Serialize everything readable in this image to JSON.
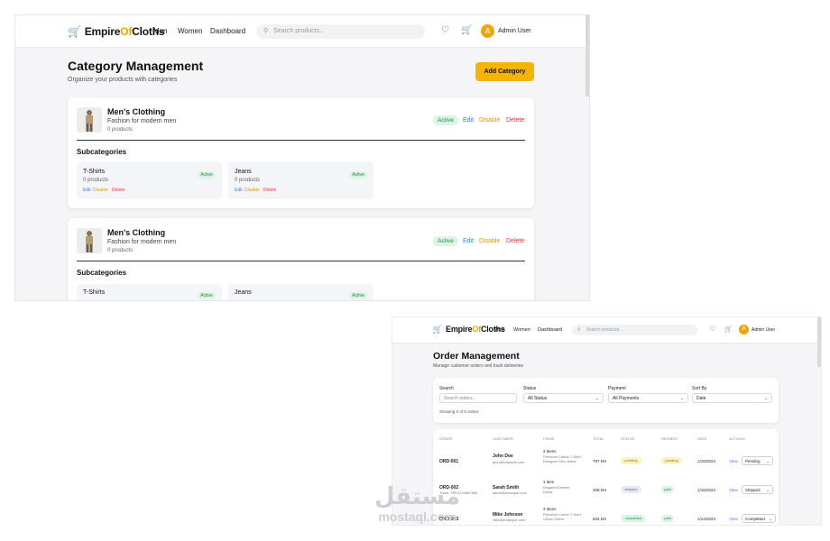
{
  "brand": {
    "prefix": "Empire",
    "accent": "Of",
    "suffix": "Cloths",
    "accent_color": "#f0a500"
  },
  "nav": {
    "links": [
      "Men",
      "Women",
      "Dashboard"
    ],
    "search_placeholder": "Search products...",
    "icons": [
      "heart-icon",
      "cart-icon"
    ],
    "avatar_initial": "A",
    "user_name": "Admin User"
  },
  "category_page": {
    "title": "Category Management",
    "subtitle": "Organize your products with categories",
    "add_button": "Add Category",
    "categories": [
      {
        "name": "Men's Clothing",
        "description": "Fashion for modern men",
        "count": "0 products",
        "status": "Active",
        "actions": {
          "edit": "Edit",
          "disable": "Disable",
          "delete": "Delete"
        },
        "subcategories_title": "Subcategories",
        "subcategories": [
          {
            "name": "T-Shirts",
            "count": "0 products",
            "status": "Active",
            "actions": {
              "edit": "Edit",
              "disable": "Disable",
              "delete": "Delete"
            }
          },
          {
            "name": "Jeans",
            "count": "0 products",
            "status": "Active",
            "actions": {
              "edit": "Edit",
              "disable": "Disable",
              "delete": "Delete"
            }
          }
        ]
      },
      {
        "name": "Men's Clothing",
        "description": "Fashion for modern men",
        "count": "0 products",
        "status": "Active",
        "actions": {
          "edit": "Edit",
          "disable": "Disable",
          "delete": "Delete"
        },
        "subcategories_title": "Subcategories",
        "subcategories": [
          {
            "name": "T-Shirts",
            "status": "Active"
          },
          {
            "name": "Jeans",
            "status": "Active"
          }
        ]
      }
    ]
  },
  "order_page": {
    "title": "Order Management",
    "subtitle": "Manage customer orders and track deliveries",
    "filters": {
      "search_label": "Search",
      "search_placeholder": "Search orders...",
      "status_label": "Status",
      "status_value": "All Status",
      "payment_label": "Payment",
      "payment_value": "All Payments",
      "sort_label": "Sort By",
      "sort_value": "Date",
      "showing": "Showing 5 of 5 orders"
    },
    "columns": [
      "Order",
      "Customer",
      "Items",
      "Total",
      "Status",
      "Payment",
      "Date",
      "Actions"
    ],
    "rows": [
      {
        "order": "ORD-001",
        "tracking": "",
        "customer": "John Doe",
        "email": "john@example.com",
        "items_count": "2 items",
        "items_desc": "Premium Cotton T-Shirt, Designer Slim Jeans",
        "total": "797 DH",
        "status": "pending",
        "payment": "pending",
        "date": "1/15/2024",
        "view": "View",
        "action_value": "Pending"
      },
      {
        "order": "ORD-002",
        "tracking": "Track: TRK1234567890",
        "customer": "Sarah Smith",
        "email": "sarah@example.com",
        "items_count": "1 item",
        "items_desc": "Elegant Summer Dress",
        "total": "208 DH",
        "status": "shipped",
        "payment": "paid",
        "date": "1/15/2024",
        "view": "View",
        "action_value": "Shipped"
      },
      {
        "order": "ORD-003",
        "tracking": "",
        "customer": "Mike Johnson",
        "email": "mike@example.com",
        "items_count": "3 items",
        "items_desc": "Premium Cotton T-Shirt, Urban Street",
        "total": "634 DH",
        "status": "completed",
        "payment": "paid",
        "date": "1/14/2024",
        "view": "View",
        "action_value": "Completed"
      }
    ]
  },
  "watermark": {
    "arabic": "مستقل",
    "latin": "mostaql.com"
  }
}
